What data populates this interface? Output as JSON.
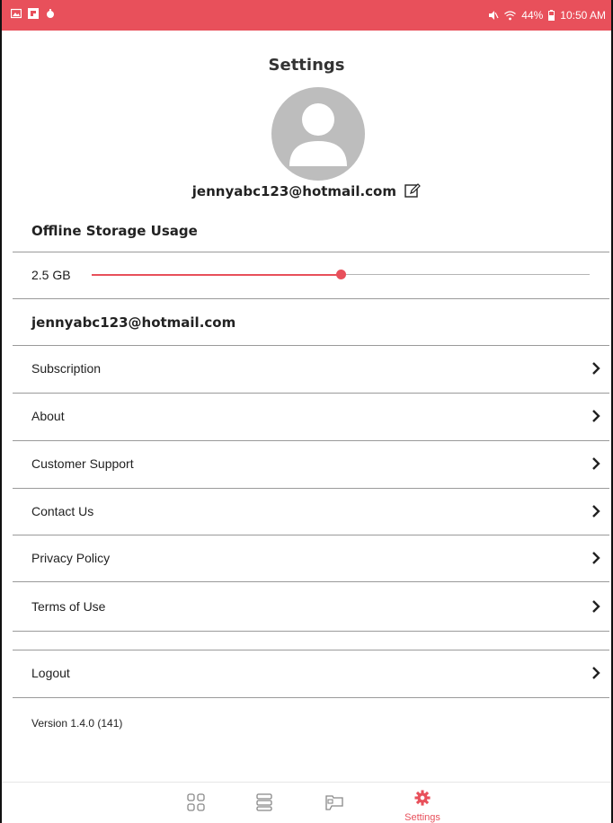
{
  "status_bar": {
    "battery": "44%",
    "time": "10:50 AM",
    "background_color": "#e8505b",
    "icons": [
      "gallery-icon",
      "flipboard-icon",
      "notification-icon",
      "mute-icon",
      "wifi-icon",
      "battery-icon"
    ]
  },
  "header": {
    "title": "Settings"
  },
  "profile": {
    "email": "jennyabc123@hotmail.com",
    "avatar_icon": "user-silhouette-icon",
    "edit_icon": "edit-icon"
  },
  "storage": {
    "section_title": "Offline Storage Usage",
    "value_label": "2.5 GB",
    "slider_fraction": 0.5,
    "accent_color": "#e8505b"
  },
  "account": {
    "email": "jennyabc123@hotmail.com"
  },
  "menu": {
    "items": [
      {
        "label": "Subscription"
      },
      {
        "label": "About"
      },
      {
        "label": "Customer Support"
      },
      {
        "label": "Contact Us"
      },
      {
        "label": "Privacy Policy"
      },
      {
        "label": "Terms of Use"
      }
    ],
    "logout_label": "Logout",
    "chevron_icon": "chevron-right-icon"
  },
  "version": "Version 1.4.0 (141)",
  "tab_bar": {
    "tabs": [
      {
        "icon": "grid-icon",
        "label": ""
      },
      {
        "icon": "list-icon",
        "label": ""
      },
      {
        "icon": "library-icon",
        "label": ""
      },
      {
        "icon": "gear-icon",
        "label": "Settings",
        "active": true
      }
    ],
    "active_color": "#e8505b"
  }
}
